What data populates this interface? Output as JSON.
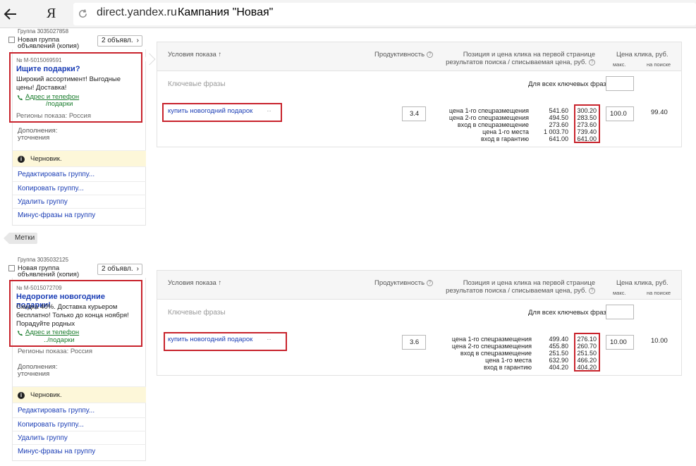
{
  "browser": {
    "logo": "Я",
    "url": "direct.yandex.ru",
    "title": "Кампания \"Новая\""
  },
  "groups": [
    {
      "group_number": "Группа 3035027858",
      "group_name_line1": "Новая группа",
      "group_name_line2": "объявлений (копия)",
      "ads_button": "2 объявл.",
      "ad": {
        "number": "№ M-5015069591",
        "title": "Ищите подарки?",
        "text_lines": [
          "Широкий ассортимент! Выгодные",
          "цены! Доставка!"
        ],
        "contact_link": "Адрес и телефон",
        "display_path": "/подарки",
        "regions": "Регионы показа: Россия"
      },
      "extras_line1": "Дополнения:",
      "extras_line2": "уточнения",
      "status": "Черновик.",
      "actions": [
        "Редактировать группу...",
        "Копировать группу...",
        "Удалить группу",
        "Минус-фразы на группу"
      ],
      "table": {
        "header_conditions": "Условия показа ↑",
        "header_productivity": "Продуктивность",
        "header_position_line1": "Позиция и цена клика на первой странице",
        "header_position_line2": "результатов поиска / списываемая цена, руб.",
        "header_price": "Цена клика, руб.",
        "header_max": "макс.",
        "header_on_search": "на поиске",
        "keywords_label": "Ключевые фразы",
        "for_all_label": "Для всех ключевых фраз:",
        "for_all_value": "",
        "phrase": "купить новогодний подарок",
        "dots": "···",
        "productivity": "3.4",
        "positions": [
          "цена 1-го спецразмещения",
          "цена 2-го спецразмещения",
          "вход в спецразмещение",
          "цена 1-го места",
          "вход в гарантию"
        ],
        "bids": [
          "541.60",
          "494.50",
          "273.60",
          "1 003.70",
          "641.00"
        ],
        "prices": [
          "300.20",
          "283.50",
          "273.60",
          "739.40",
          "641.00"
        ],
        "max_bid": "100.0",
        "on_search": "99.40"
      }
    },
    {
      "group_number": "Группа 3035032125",
      "group_name_line1": "Новая группа",
      "group_name_line2": "объявлений (копия)",
      "ads_button": "2 объявл.",
      "ad": {
        "number": "№ M-5015072709",
        "title": "Недорогие новогодние подарки!",
        "text_lines": [
          "Скидка 40%. Доставка курьером",
          "бесплатно! Только до конца ноября!",
          "Порадуйте родных"
        ],
        "contact_link": "Адрес и телефон",
        "display_path": "../подарки",
        "regions": "Регионы показа: Россия"
      },
      "extras_line1": "Дополнения:",
      "extras_line2": "уточнения",
      "status": "Черновик.",
      "actions": [
        "Редактировать группу...",
        "Копировать группу...",
        "Удалить группу",
        "Минус-фразы на группу"
      ],
      "table": {
        "header_conditions": "Условия показа ↑",
        "header_productivity": "Продуктивность",
        "header_position_line1": "Позиция и цена клика на первой странице",
        "header_position_line2": "результатов поиска / списываемая цена, руб.",
        "header_price": "Цена клика, руб.",
        "header_max": "макс.",
        "header_on_search": "на поиске",
        "keywords_label": "Ключевые фразы",
        "for_all_label": "Для всех ключевых фраз:",
        "for_all_value": "",
        "phrase": "купить новогодний подарок",
        "dots": "···",
        "productivity": "3.6",
        "positions": [
          "цена 1-го спецразмещения",
          "цена 2-го спецразмещения",
          "вход в спецразмещение",
          "цена 1-го места",
          "вход в гарантию"
        ],
        "bids": [
          "499.40",
          "455.80",
          "251.50",
          "632.90",
          "404.20"
        ],
        "prices": [
          "276.10",
          "260.70",
          "251.50",
          "466.20",
          "404.20"
        ],
        "max_bid": "10.00",
        "on_search": "10.00"
      }
    }
  ],
  "tags_button": "Метки",
  "colors": {
    "highlight": "#c8232c",
    "link": "#1a3db5",
    "contact": "#1a7c2d",
    "draft_bg": "#fdf7d9"
  },
  "icons": [
    "back-arrow-icon",
    "reload-icon",
    "phone-icon",
    "info-icon",
    "question-icon",
    "chevron-right-icon"
  ]
}
